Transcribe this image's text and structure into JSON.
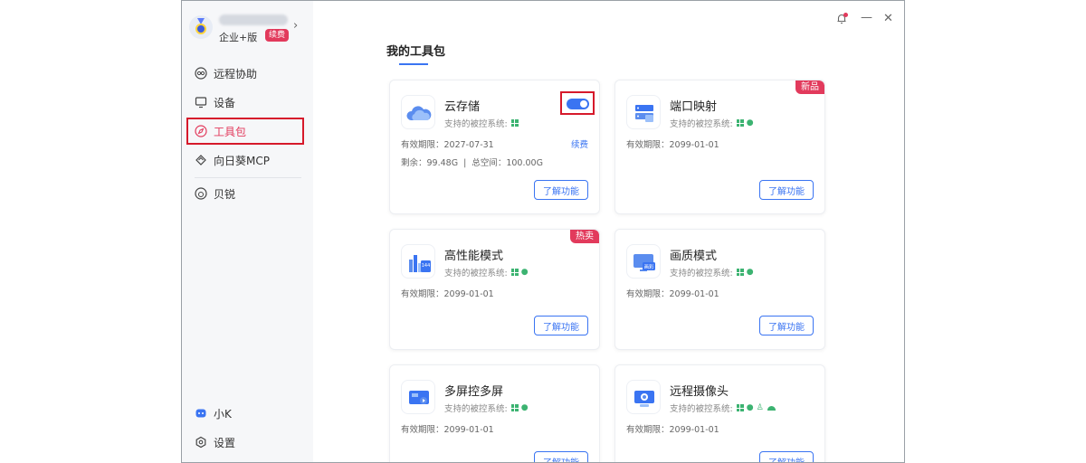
{
  "profile": {
    "edition": "企业+版",
    "renew_badge": "续费"
  },
  "sidebar": {
    "items": [
      {
        "label": "远程协助",
        "icon": "remote-assist-icon"
      },
      {
        "label": "设备",
        "icon": "monitor-icon"
      },
      {
        "label": "工具包",
        "icon": "compass-icon",
        "active": true
      },
      {
        "label": "向日葵MCP",
        "icon": "mcp-icon"
      },
      {
        "label": "贝锐",
        "icon": "oray-icon"
      }
    ],
    "bottom_items": [
      {
        "label": "小K",
        "icon": "assistant-icon"
      },
      {
        "label": "设置",
        "icon": "gear-icon"
      }
    ]
  },
  "colors": {
    "accent": "#3a74f2",
    "brand_red": "#e23a5c",
    "os_green": "#3cb371",
    "highlight_box": "#d6192b"
  },
  "page": {
    "title": "我的工具包"
  },
  "cards": [
    {
      "name": "云存储",
      "sys_label": "支持的被控系统:",
      "os": [
        "windows"
      ],
      "expiry": "有效期限：2027-07-31",
      "storage": "剩余：99.48G  |  总空间：100.00G",
      "renew": "续费",
      "button": "了解功能",
      "toggle_on": true
    },
    {
      "name": "端口映射",
      "sys_label": "支持的被控系统:",
      "os": [
        "windows",
        "apple"
      ],
      "expiry": "有效期限：2099-01-01",
      "button": "了解功能",
      "tag": "新品"
    },
    {
      "name": "高性能模式",
      "sys_label": "支持的被控系统:",
      "os": [
        "windows",
        "apple"
      ],
      "expiry": "有效期限：2099-01-01",
      "button": "了解功能",
      "tag": "热卖"
    },
    {
      "name": "画质模式",
      "sys_label": "支持的被控系统:",
      "os": [
        "windows",
        "apple"
      ],
      "expiry": "有效期限：2099-01-01",
      "button": "了解功能"
    },
    {
      "name": "多屏控多屏",
      "sys_label": "支持的被控系统:",
      "os": [
        "windows",
        "apple"
      ],
      "expiry": "有效期限：2099-01-01",
      "button": "了解功能"
    },
    {
      "name": "远程摄像头",
      "sys_label": "支持的被控系统:",
      "os": [
        "windows",
        "apple",
        "linux",
        "android"
      ],
      "expiry": "有效期限：2099-01-01",
      "button": "了解功能"
    }
  ],
  "icon_text": {
    "fps": "144",
    "hd": "画彩"
  }
}
